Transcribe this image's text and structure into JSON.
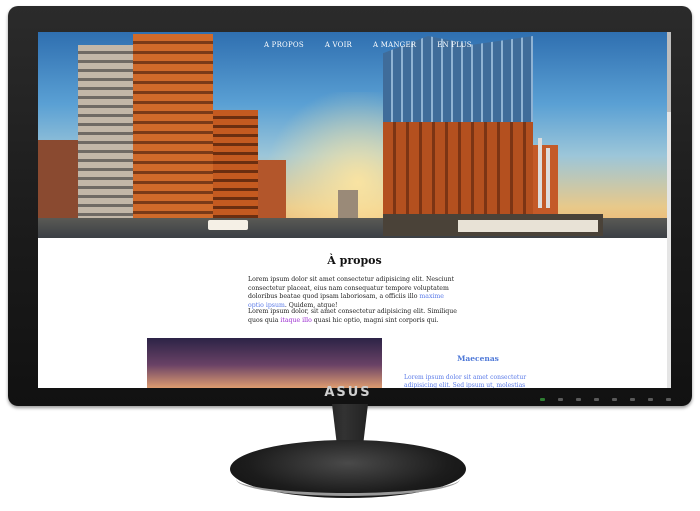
{
  "monitor": {
    "brand": "ASUS"
  },
  "nav": {
    "items": [
      "A PROPOS",
      "A VOIR",
      "A MANGER",
      "EN PLUS"
    ]
  },
  "about": {
    "title": "À propos",
    "p1_a": "Lorem ipsum dolor sit amet consectetur adipisicing elit. Nesciunt consectetur placeat, eius nam consequatur tempore voluptatem doloribus beatae quod ipsam laboriosam, a officiis illo ",
    "p1_link": "maxime optio ipsum",
    "p1_b": ". Quidem, atque!",
    "p2_a": "Lorem ipsum dolor, sit amet consectetur adipisicing elit. Similique quos quia ",
    "p2_link": "itaque illo",
    "p2_b": " quasi hic optio, magni sint corporis qui."
  },
  "side": {
    "title": "Maecenas",
    "text": "Lorem ipsum dolor sit amet consectetur adipisicing elit. Sed ipsum ut, molestias laudantium quo dolore"
  },
  "colors": {
    "link_blue": "#5b7be8",
    "link_purple": "#9b2bd0",
    "side_title": "#4f79d8"
  }
}
